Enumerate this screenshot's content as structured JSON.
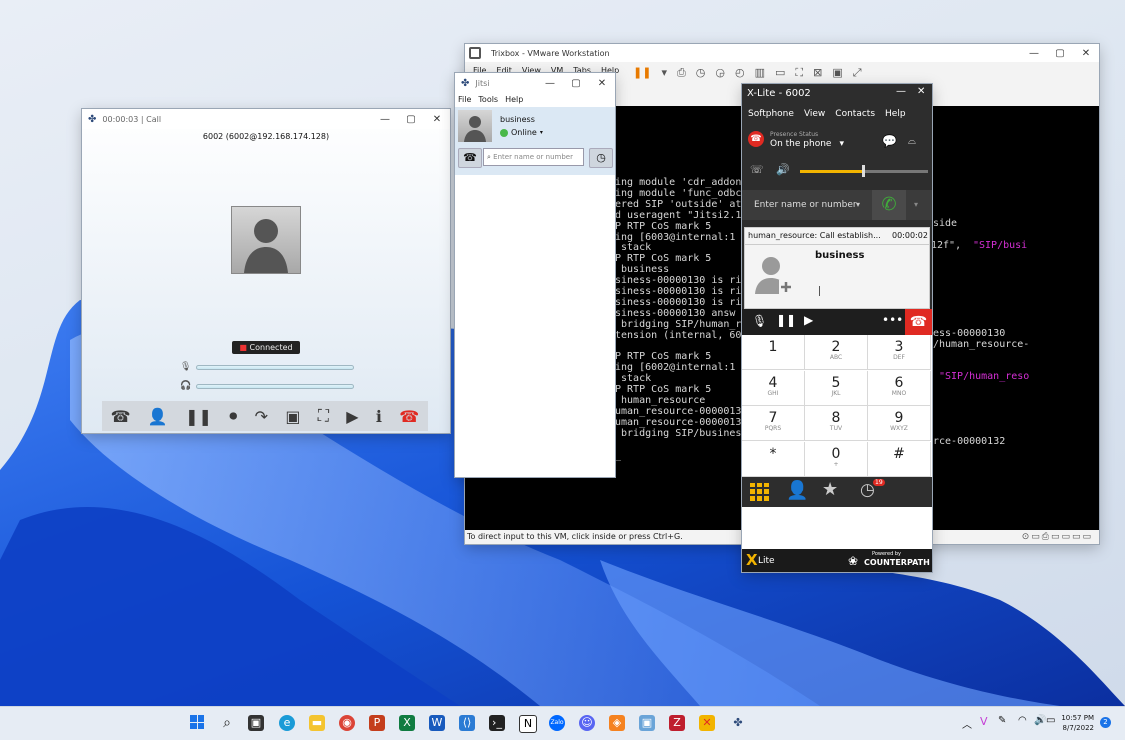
{
  "vmware": {
    "title": "Trixbox - VMware Workstation",
    "menu": [
      "File",
      "Edit",
      "View",
      "VM",
      "Tabs",
      "Help"
    ],
    "status_text": "To direct input to this VM, click inside or press Ctrl+G.",
    "console_lines": [
      "ing module 'cdr_addon",
      "ing module 'func_odbc",
      "ered SIP 'outside' at",
      "d useragent \"Jitsi2.1",
      "P RTP CoS mark 5",
      "ing [6003@internal:1",
      " stack",
      "P RTP CoS mark 5",
      " business",
      "siness-00000130 is ri",
      "siness-00000130 is ri",
      "siness-00000130 is ri",
      "siness-00000130 answ",
      " bridging SIP/human_r",
      "tension (internal, 60",
      "",
      "P RTP CoS mark 5",
      "ing [6002@internal:1",
      " stack",
      "P RTP CoS mark 5",
      " human_resource",
      "uman_resource-0000013",
      "uman_resource-0000013",
      " bridging SIP/busines",
      "",
      "_"
    ],
    "console_right": {
      "r1": "side",
      "r2a": "12f\", ",
      "r2b": "\"SIP/busi",
      "r3": "ess-00000130",
      "r4": "/human_resource-",
      "r5": "\"SIP/human_reso",
      "r6": "rce-00000132"
    }
  },
  "call_window": {
    "title": "00:00:03 | Call",
    "peer": "6002 (6002@192.168.174.128)",
    "status": "Connected",
    "tools": [
      "phone-dial-icon",
      "add-participant-icon",
      "pause-icon",
      "record-icon",
      "transfer-icon",
      "desktop-share-icon",
      "fullscreen-icon",
      "video-icon",
      "info-icon",
      "hangup-icon"
    ]
  },
  "jitsi": {
    "title": "Jitsi",
    "menu": [
      "File",
      "Tools",
      "Help"
    ],
    "account_name": "business",
    "status": "Online",
    "search_placeholder": "Enter name or number"
  },
  "xlite": {
    "title": "X-Lite - 6002",
    "menu": [
      "Softphone",
      "View",
      "Contacts",
      "Help"
    ],
    "presence_label": "Presence Status",
    "presence_value": "On the phone",
    "dial_placeholder": "Enter name or number",
    "call_title": "human_resource: Call establish...",
    "call_timer": "00:00:02",
    "call_contact": "business",
    "keypad": [
      {
        "d": "1",
        "l": ""
      },
      {
        "d": "2",
        "l": "ABC"
      },
      {
        "d": "3",
        "l": "DEF"
      },
      {
        "d": "4",
        "l": "GHI"
      },
      {
        "d": "5",
        "l": "JKL"
      },
      {
        "d": "6",
        "l": "MNO"
      },
      {
        "d": "7",
        "l": "PQRS"
      },
      {
        "d": "8",
        "l": "TUV"
      },
      {
        "d": "9",
        "l": "WXYZ"
      },
      {
        "d": "*",
        "l": ""
      },
      {
        "d": "0",
        "l": "+"
      },
      {
        "d": "#",
        "l": ""
      }
    ],
    "history_badge": "19",
    "brand": "Lite",
    "powered_by": "Powered by",
    "counterpath": "COUNTERPATH"
  },
  "taskbar": {
    "time": "10:57 PM",
    "date": "8/7/2022",
    "notification_count": "2"
  },
  "colors": {
    "xlite_dark": "#2d2d2d",
    "hangup_red": "#e02a22",
    "call_green": "#3fae3a",
    "accent_yellow": "#f2b400",
    "terminal_magenta": "#d42fd4"
  }
}
